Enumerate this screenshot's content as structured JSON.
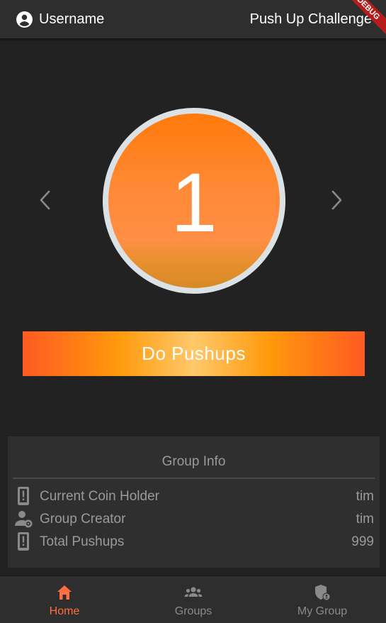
{
  "app_bar": {
    "username": "Username",
    "title": "Push Up Challenge",
    "debug_banner": "DEBUG",
    "user_icon": "account-circle-icon"
  },
  "counter": {
    "value": "1",
    "prev_icon": "chevron-left-icon",
    "next_icon": "chevron-right-icon"
  },
  "action_button": {
    "label": "Do Pushups"
  },
  "group_info": {
    "title": "Group Info",
    "rows": [
      {
        "icon": "phone-alert-icon",
        "label": "Current Coin Holder",
        "value": "tim"
      },
      {
        "icon": "person-settings-icon",
        "label": "Group Creator",
        "value": "tim"
      },
      {
        "icon": "phone-alert-icon",
        "label": "Total Pushups",
        "value": "999"
      }
    ]
  },
  "bottom_nav": {
    "items": [
      {
        "label": "Home",
        "icon": "home-icon",
        "active": true
      },
      {
        "label": "Groups",
        "icon": "groups-icon",
        "active": false
      },
      {
        "label": "My Group",
        "icon": "shield-person-icon",
        "active": false
      }
    ]
  },
  "colors": {
    "background": "#222222",
    "bar": "#2e2e2e",
    "accent": "#ff6e40",
    "counter_orange": "#ff7a0a",
    "muted_text": "#9a9a9a"
  }
}
